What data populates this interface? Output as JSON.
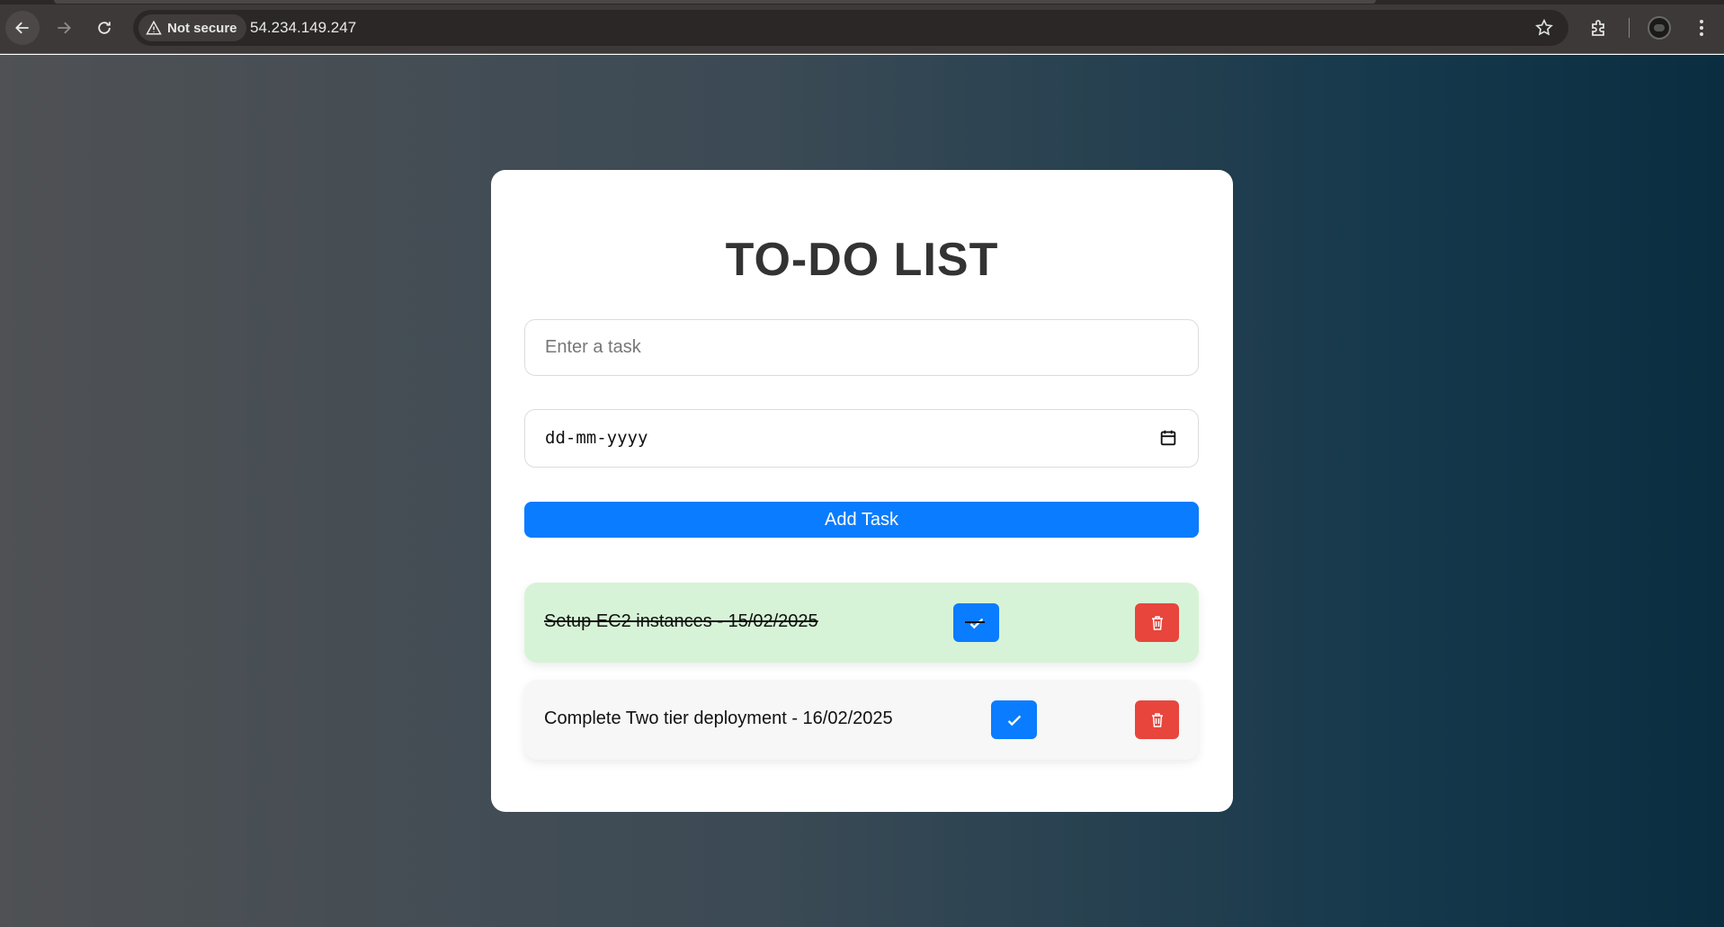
{
  "browser": {
    "security_label": "Not secure",
    "url": "54.234.149.247"
  },
  "app": {
    "title": "TO-DO LIST",
    "task_input_placeholder": "Enter a task",
    "date_placeholder": "dd-mm-yyyy",
    "add_button_label": "Add Task",
    "tasks": [
      {
        "text": "Setup EC2 instances - 15/02/2025",
        "completed": true,
        "background": "#d7f3d7"
      },
      {
        "text": "Complete Two tier deployment - 16/02/2025",
        "completed": false,
        "background": "#f7f7f7"
      }
    ]
  },
  "colors": {
    "primary": "#0a7cff",
    "danger": "#e8453c",
    "completed_bg": "#d7f3d7"
  }
}
